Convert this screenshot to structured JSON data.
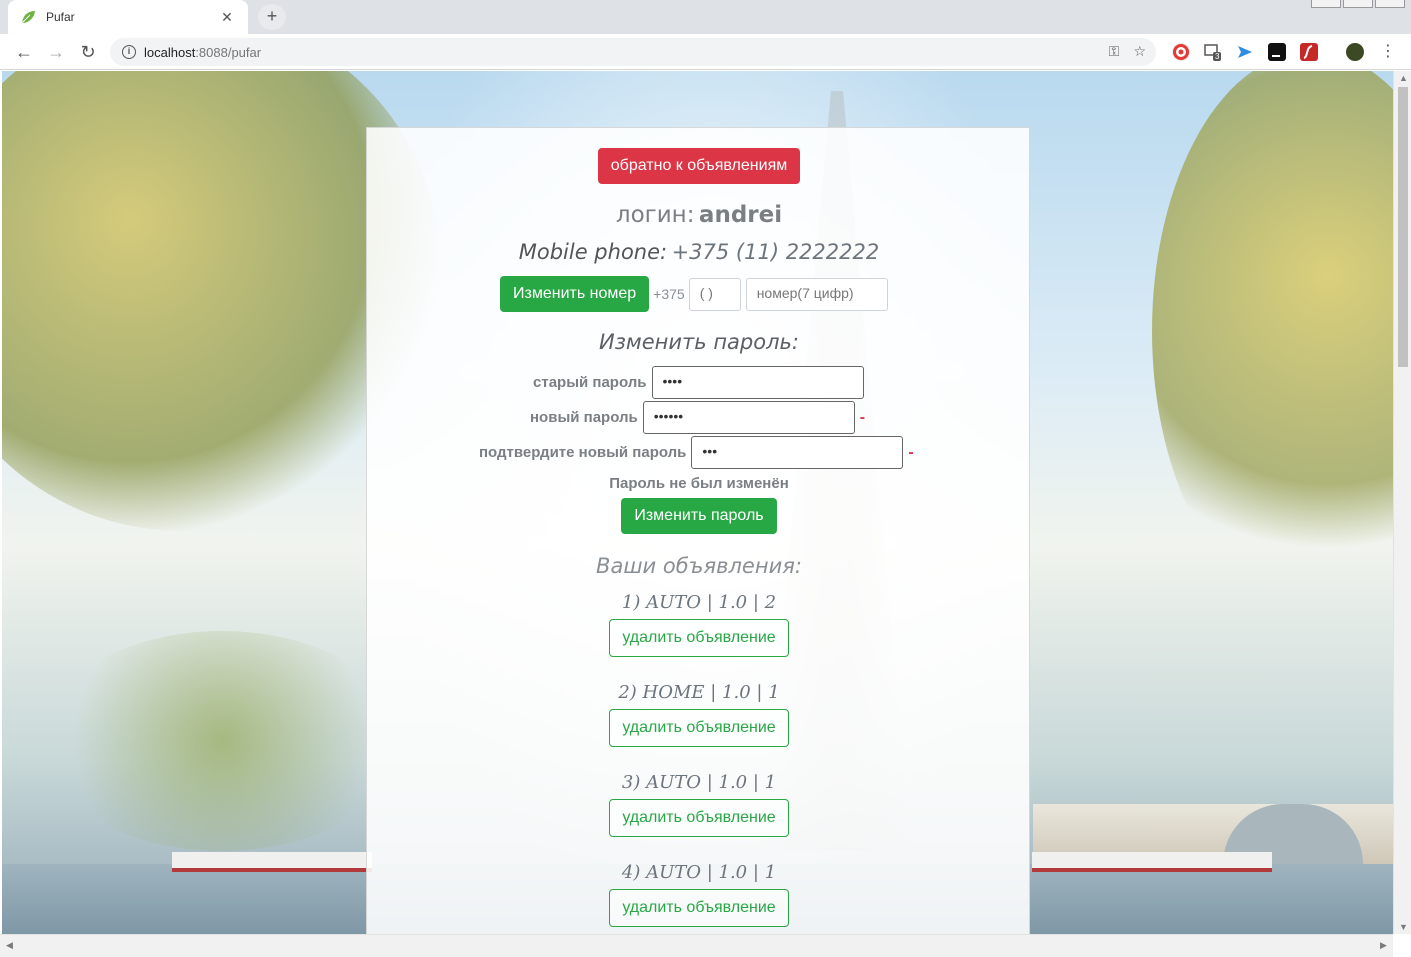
{
  "browser": {
    "tab_title": "Pufar",
    "tab_close": "✕",
    "new_tab": "+",
    "url_host": "localhost",
    "url_rest": ":8088/pufar",
    "extension_badge": "3"
  },
  "page": {
    "back_button": "обратно к объявлениям",
    "login_label": "логин:",
    "login_value": "andrei",
    "phone_label": "Mobile phone:",
    "phone_value": "+375 (11) 2222222",
    "change_number_button": "Изменить номер",
    "country_code": "+375",
    "area_code_placeholder": "(  )",
    "number_placeholder": "номер(7 цифр)",
    "password_section_title": "Изменить пароль:",
    "old_password_label": "старый пароль",
    "old_password_value": "••••",
    "new_password_label": "новый пароль",
    "new_password_value": "••••••",
    "new_password_mark": "-",
    "confirm_password_label": "подтвердите новый пароль",
    "confirm_password_value": "•••",
    "confirm_password_mark": "-",
    "status_message": "Пароль не был изменён",
    "change_password_button": "Изменить пароль",
    "ads_title": "Ваши объявления:",
    "ads": [
      {
        "text": "1) AUTO | 1.0 | 2",
        "delete_label": "удалить объявление"
      },
      {
        "text": "2) HOME | 1.0 | 1",
        "delete_label": "удалить объявление"
      },
      {
        "text": "3) AUTO | 1.0 | 1",
        "delete_label": "удалить объявление"
      },
      {
        "text": "4) AUTO | 1.0 | 1",
        "delete_label": "удалить объявление"
      }
    ]
  },
  "colors": {
    "danger": "#dc3545",
    "success": "#28a745"
  }
}
